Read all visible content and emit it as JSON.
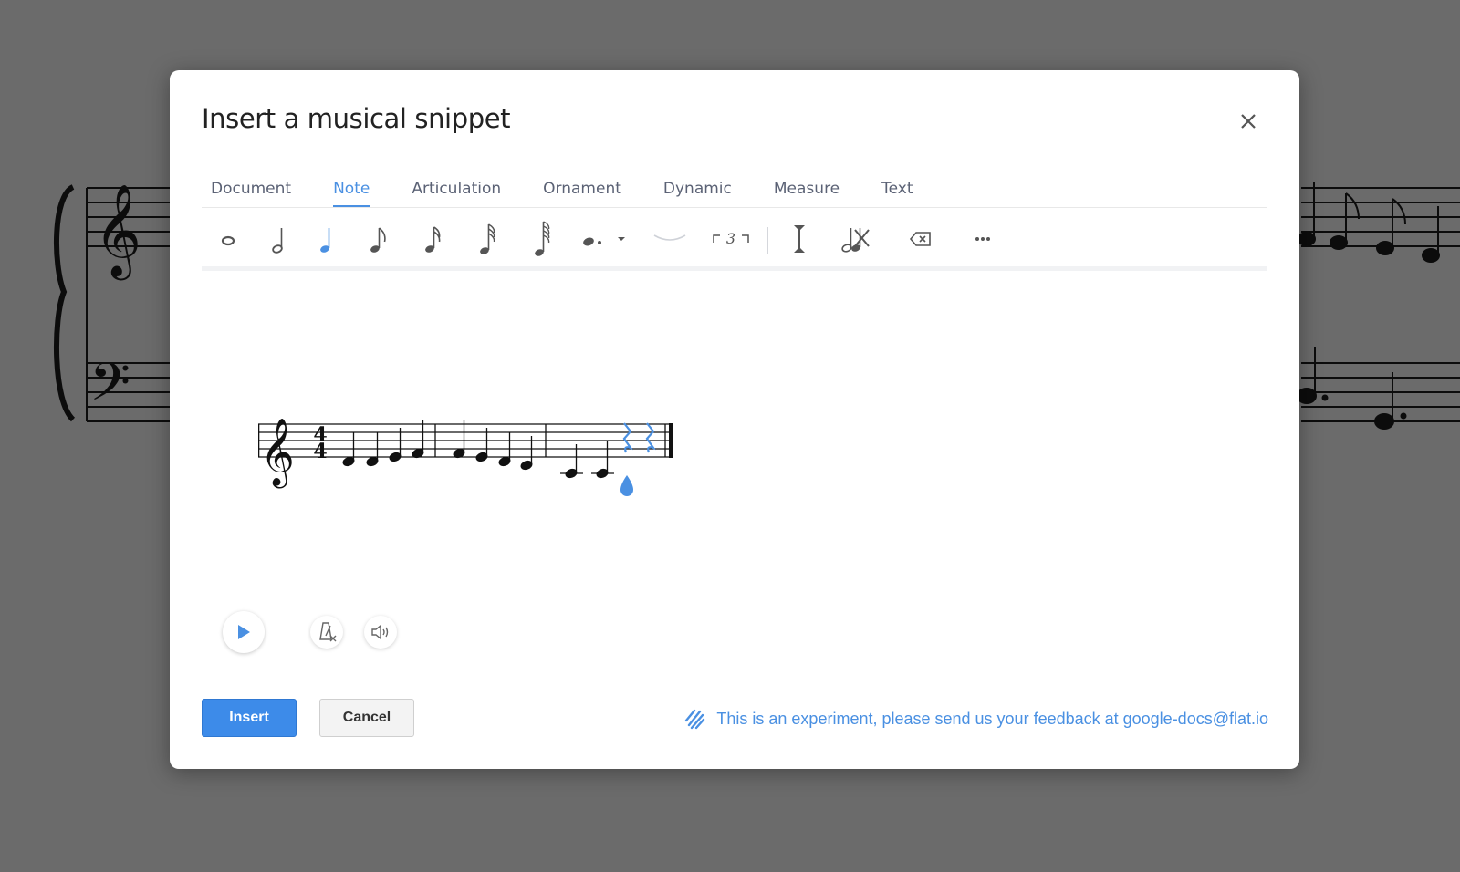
{
  "dialog": {
    "title": "Insert a musical snippet"
  },
  "tabs": [
    {
      "label": "Document"
    },
    {
      "label": "Note"
    },
    {
      "label": "Articulation"
    },
    {
      "label": "Ornament"
    },
    {
      "label": "Dynamic"
    },
    {
      "label": "Measure"
    },
    {
      "label": "Text"
    }
  ],
  "active_tab": "Note",
  "toolbar": {
    "tuplet_label": "3",
    "icons": [
      "whole-note-icon",
      "half-note-icon",
      "quarter-note-icon",
      "eighth-note-icon",
      "sixteenth-note-icon",
      "thirty-second-note-icon",
      "sixty-fourth-note-icon",
      "dot-icon",
      "dot-dropdown-icon",
      "tie-icon",
      "tuplet-icon",
      "cursor-icon",
      "rest-toggle-icon",
      "delete-icon",
      "more-icon"
    ]
  },
  "score": {
    "time_signature": {
      "top": "4",
      "bottom": "4"
    },
    "clef": "treble"
  },
  "actions": {
    "insert_label": "Insert",
    "cancel_label": "Cancel"
  },
  "feedback": {
    "text": "This is an experiment, please send us your feedback at google-docs@flat.io"
  },
  "colors": {
    "accent": "#4a90e2",
    "overlay": "#6b6b6b",
    "insert": "#3d8be9"
  }
}
